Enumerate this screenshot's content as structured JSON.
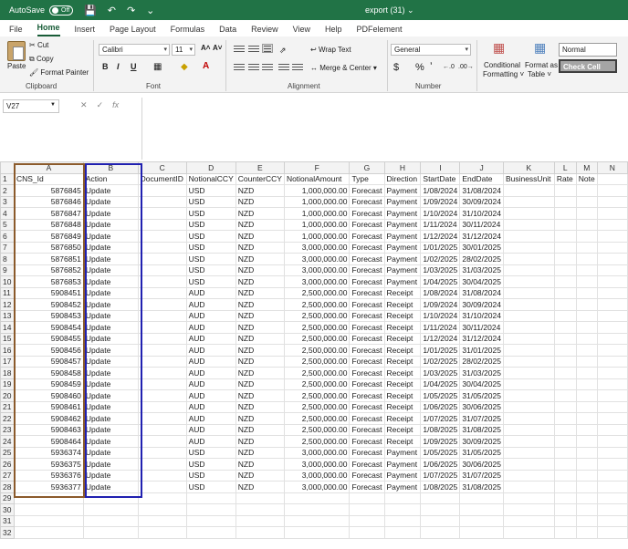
{
  "titlebar": {
    "autosave_label": "AutoSave",
    "autosave_state": "Off",
    "filename": "export (31) ⌄"
  },
  "menu": {
    "tabs": [
      "File",
      "Home",
      "Insert",
      "Page Layout",
      "Formulas",
      "Data",
      "Review",
      "View",
      "Help",
      "PDFelement"
    ],
    "active": "Home"
  },
  "ribbon": {
    "clipboard": {
      "paste": "Paste",
      "cut": "Cut",
      "copy": "Copy",
      "format_painter": "Format Painter",
      "label": "Clipboard"
    },
    "font": {
      "name": "Calibri",
      "size": "11",
      "label": "Font",
      "bold": "B",
      "italic": "I",
      "underline": "U",
      "grow": "A˄",
      "shrink": "A˅"
    },
    "alignment": {
      "wrap": "Wrap Text",
      "merge": "Merge & Center",
      "label": "Alignment"
    },
    "number": {
      "format": "General",
      "label": "Number",
      "currency": "$",
      "percent": "%",
      "comma": "ʼ"
    },
    "styles": {
      "conditional": "Conditional",
      "conditional2": "Formatting ˅",
      "format_as": "Format as",
      "format_as2": "Table ˅",
      "normal": "Normal",
      "check_cell": "Check Cell"
    }
  },
  "formula_bar": {
    "name_box": "V27",
    "fx": "fx",
    "value": ""
  },
  "grid": {
    "columns": [
      "A",
      "B",
      "C",
      "D",
      "E",
      "F",
      "G",
      "H",
      "I",
      "J",
      "K",
      "L",
      "M",
      "N"
    ],
    "header_row": [
      "CNS_Id",
      "Action",
      "DocumentID",
      "NotionalCCY",
      "CounterCCY",
      "NotionalAmount",
      "Type",
      "Direction",
      "StartDate",
      "EndDate",
      "BusinessUnit",
      "Rate",
      "Note",
      ""
    ],
    "rows": [
      [
        "5876845",
        "Update",
        "",
        "USD",
        "NZD",
        "1,000,000.00",
        "Forecast",
        "Payment",
        "1/08/2024",
        "31/08/2024"
      ],
      [
        "5876846",
        "Update",
        "",
        "USD",
        "NZD",
        "1,000,000.00",
        "Forecast",
        "Payment",
        "1/09/2024",
        "30/09/2024"
      ],
      [
        "5876847",
        "Update",
        "",
        "USD",
        "NZD",
        "1,000,000.00",
        "Forecast",
        "Payment",
        "1/10/2024",
        "31/10/2024"
      ],
      [
        "5876848",
        "Update",
        "",
        "USD",
        "NZD",
        "1,000,000.00",
        "Forecast",
        "Payment",
        "1/11/2024",
        "30/11/2024"
      ],
      [
        "5876849",
        "Update",
        "",
        "USD",
        "NZD",
        "1,000,000.00",
        "Forecast",
        "Payment",
        "1/12/2024",
        "31/12/2024"
      ],
      [
        "5876850",
        "Update",
        "",
        "USD",
        "NZD",
        "3,000,000.00",
        "Forecast",
        "Payment",
        "1/01/2025",
        "30/01/2025"
      ],
      [
        "5876851",
        "Update",
        "",
        "USD",
        "NZD",
        "3,000,000.00",
        "Forecast",
        "Payment",
        "1/02/2025",
        "28/02/2025"
      ],
      [
        "5876852",
        "Update",
        "",
        "USD",
        "NZD",
        "3,000,000.00",
        "Forecast",
        "Payment",
        "1/03/2025",
        "31/03/2025"
      ],
      [
        "5876853",
        "Update",
        "",
        "USD",
        "NZD",
        "3,000,000.00",
        "Forecast",
        "Payment",
        "1/04/2025",
        "30/04/2025"
      ],
      [
        "5908451",
        "Update",
        "",
        "AUD",
        "NZD",
        "2,500,000.00",
        "Forecast",
        "Receipt",
        "1/08/2024",
        "31/08/2024"
      ],
      [
        "5908452",
        "Update",
        "",
        "AUD",
        "NZD",
        "2,500,000.00",
        "Forecast",
        "Receipt",
        "1/09/2024",
        "30/09/2024"
      ],
      [
        "5908453",
        "Update",
        "",
        "AUD",
        "NZD",
        "2,500,000.00",
        "Forecast",
        "Receipt",
        "1/10/2024",
        "31/10/2024"
      ],
      [
        "5908454",
        "Update",
        "",
        "AUD",
        "NZD",
        "2,500,000.00",
        "Forecast",
        "Receipt",
        "1/11/2024",
        "30/11/2024"
      ],
      [
        "5908455",
        "Update",
        "",
        "AUD",
        "NZD",
        "2,500,000.00",
        "Forecast",
        "Receipt",
        "1/12/2024",
        "31/12/2024"
      ],
      [
        "5908456",
        "Update",
        "",
        "AUD",
        "NZD",
        "2,500,000.00",
        "Forecast",
        "Receipt",
        "1/01/2025",
        "31/01/2025"
      ],
      [
        "5908457",
        "Update",
        "",
        "AUD",
        "NZD",
        "2,500,000.00",
        "Forecast",
        "Receipt",
        "1/02/2025",
        "28/02/2025"
      ],
      [
        "5908458",
        "Update",
        "",
        "AUD",
        "NZD",
        "2,500,000.00",
        "Forecast",
        "Receipt",
        "1/03/2025",
        "31/03/2025"
      ],
      [
        "5908459",
        "Update",
        "",
        "AUD",
        "NZD",
        "2,500,000.00",
        "Forecast",
        "Receipt",
        "1/04/2025",
        "30/04/2025"
      ],
      [
        "5908460",
        "Update",
        "",
        "AUD",
        "NZD",
        "2,500,000.00",
        "Forecast",
        "Receipt",
        "1/05/2025",
        "31/05/2025"
      ],
      [
        "5908461",
        "Update",
        "",
        "AUD",
        "NZD",
        "2,500,000.00",
        "Forecast",
        "Receipt",
        "1/06/2025",
        "30/06/2025"
      ],
      [
        "5908462",
        "Update",
        "",
        "AUD",
        "NZD",
        "2,500,000.00",
        "Forecast",
        "Receipt",
        "1/07/2025",
        "31/07/2025"
      ],
      [
        "5908463",
        "Update",
        "",
        "AUD",
        "NZD",
        "2,500,000.00",
        "Forecast",
        "Receipt",
        "1/08/2025",
        "31/08/2025"
      ],
      [
        "5908464",
        "Update",
        "",
        "AUD",
        "NZD",
        "2,500,000.00",
        "Forecast",
        "Receipt",
        "1/09/2025",
        "30/09/2025"
      ],
      [
        "5936374",
        "Update",
        "",
        "USD",
        "NZD",
        "3,000,000.00",
        "Forecast",
        "Payment",
        "1/05/2025",
        "31/05/2025"
      ],
      [
        "5936375",
        "Update",
        "",
        "USD",
        "NZD",
        "3,000,000.00",
        "Forecast",
        "Payment",
        "1/06/2025",
        "30/06/2025"
      ],
      [
        "5936376",
        "Update",
        "",
        "USD",
        "NZD",
        "3,000,000.00",
        "Forecast",
        "Payment",
        "1/07/2025",
        "31/07/2025"
      ],
      [
        "5936377",
        "Update",
        "",
        "USD",
        "NZD",
        "3,000,000.00",
        "Forecast",
        "Payment",
        "1/08/2025",
        "31/08/2025"
      ]
    ],
    "empty_row_numbers": [
      "29",
      "30",
      "31",
      "32"
    ]
  },
  "colors": {
    "excel_green": "#217346",
    "highlight_a": "#8b5a2b",
    "highlight_b": "#2020b0"
  }
}
